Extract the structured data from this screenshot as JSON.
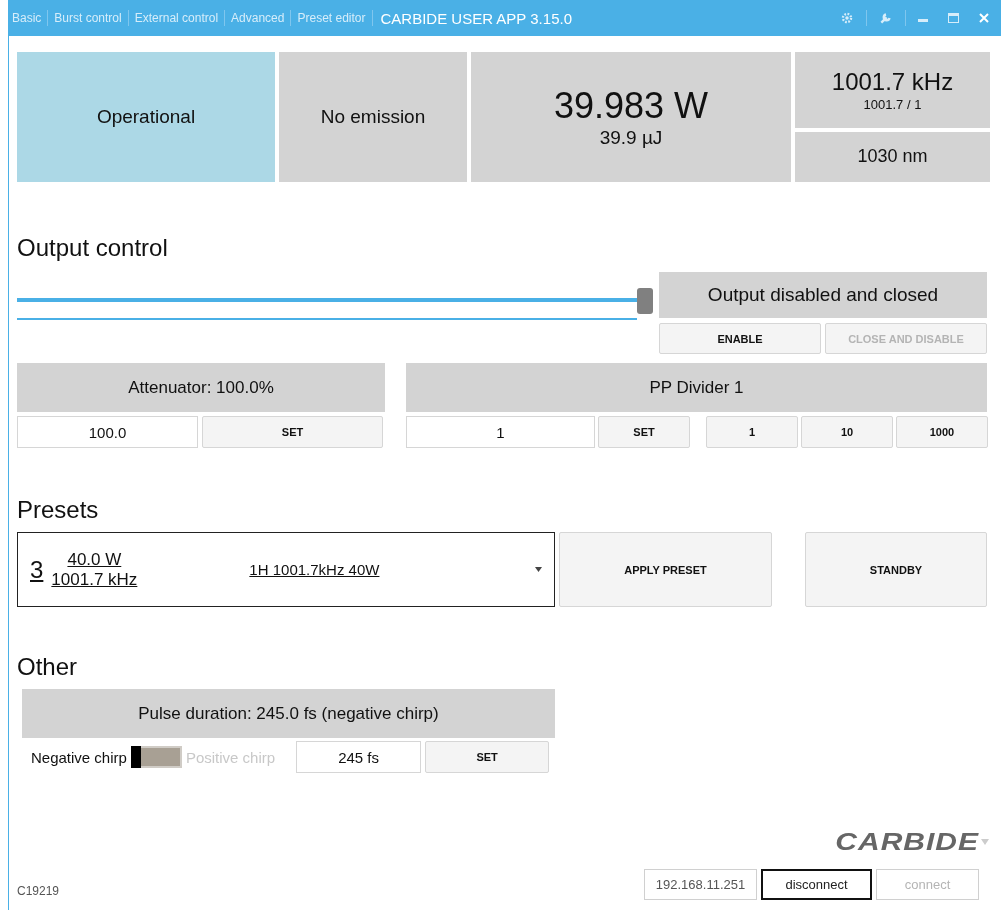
{
  "window": {
    "title": "CARBIDE USER APP 3.15.0"
  },
  "tabs": [
    "Basic",
    "Burst control",
    "External control",
    "Advanced",
    "Preset editor"
  ],
  "status": {
    "state": "Operational",
    "emission": "No emission",
    "power": "39.983 W",
    "energy": "39.9 µJ",
    "frequency": "1001.7 kHz",
    "divider_ratio": "1001.7 / 1",
    "wavelength": "1030 nm"
  },
  "output_control": {
    "heading": "Output control",
    "slider": {
      "level": 1
    },
    "status": "Output disabled and closed",
    "buttons": [
      {
        "label": "ENABLE",
        "disabled": false
      },
      {
        "label": "CLOSE AND DISABLE",
        "disabled": true
      }
    ]
  },
  "attenuator": {
    "title": "Attenuator: 100.0%",
    "value": "100.0",
    "set": "SET"
  },
  "pp_divider": {
    "title": "PP Divider 1",
    "value": "1",
    "set": "SET",
    "quick": [
      "1",
      "10",
      "1000"
    ]
  },
  "presets": {
    "heading": "Presets",
    "number": "3",
    "power": "40.0 W",
    "frequency": "1001.7 kHz",
    "name": "1H 1001.7kHz 40W",
    "apply": "APPLY PRESET",
    "standby": "STANDBY"
  },
  "other": {
    "heading": "Other",
    "pulse_title": "Pulse duration: 245.0 fs (negative chirp)",
    "negative_label": "Negative chirp",
    "positive_label": "Positive chirp",
    "positive": false,
    "value": "245 fs",
    "set": "SET"
  },
  "footer": {
    "logo": "CARBIDE",
    "serial": "C19219",
    "ip": "192.168.11.251",
    "buttons": [
      {
        "label": "disconnect",
        "disabled": false
      },
      {
        "label": "connect",
        "disabled": true
      }
    ]
  }
}
